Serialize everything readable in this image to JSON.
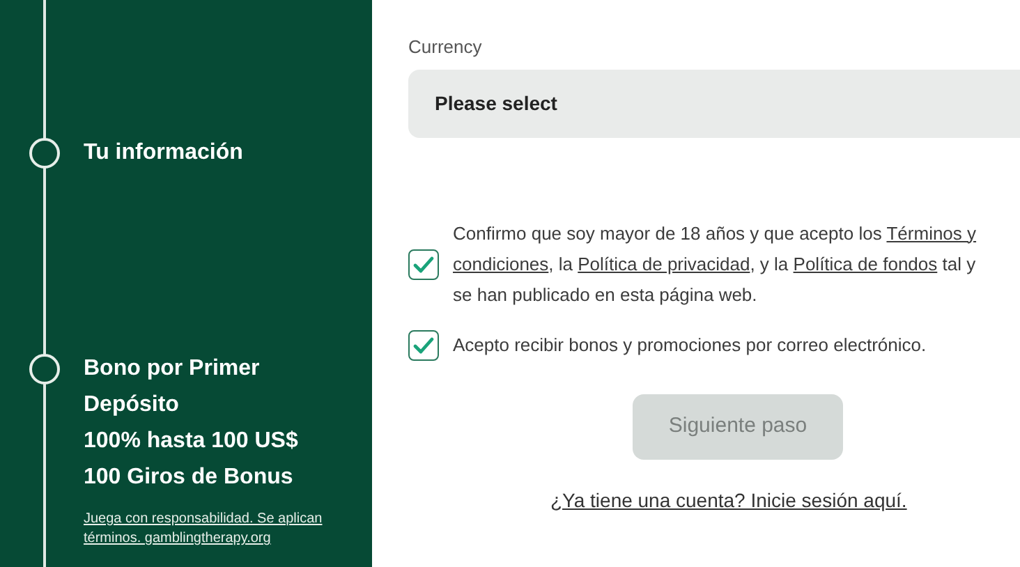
{
  "sidebar": {
    "steps": [
      {
        "lines": [
          "Tu información"
        ]
      },
      {
        "lines": [
          "Bono por Primer",
          "Depósito",
          "100% hasta 100 US$",
          "100 Giros de Bonus"
        ]
      }
    ],
    "disclaimer": "Juega con responsabilidad. Se aplican términos. gamblingtherapy.org"
  },
  "form": {
    "currency": {
      "label": "Currency",
      "placeholder": "Please select"
    },
    "consents": [
      {
        "checked": true,
        "lines": [
          [
            {
              "kind": "text",
              "text": "Confirmo que soy mayor de 18 años y que acepto los "
            },
            {
              "kind": "link",
              "text": "Términos y"
            }
          ],
          [
            {
              "kind": "link",
              "text": "condiciones"
            },
            {
              "kind": "text",
              "text": ", la "
            },
            {
              "kind": "link",
              "text": "Política de privacidad"
            },
            {
              "kind": "text",
              "text": ", y la "
            },
            {
              "kind": "link",
              "text": "Política de fondos"
            },
            {
              "kind": "text",
              "text": " tal y"
            }
          ],
          [
            {
              "kind": "text",
              "text": "se han publicado en esta página web."
            }
          ]
        ]
      },
      {
        "checked": true,
        "lines": [
          [
            {
              "kind": "text",
              "text": "Acepto recibir bonos y promociones por correo electrónico."
            }
          ]
        ]
      }
    ],
    "next_button": {
      "label": "Siguiente paso",
      "disabled": true
    },
    "login_link": "¿Ya tiene una cuenta? Inicie sesión aquí."
  }
}
